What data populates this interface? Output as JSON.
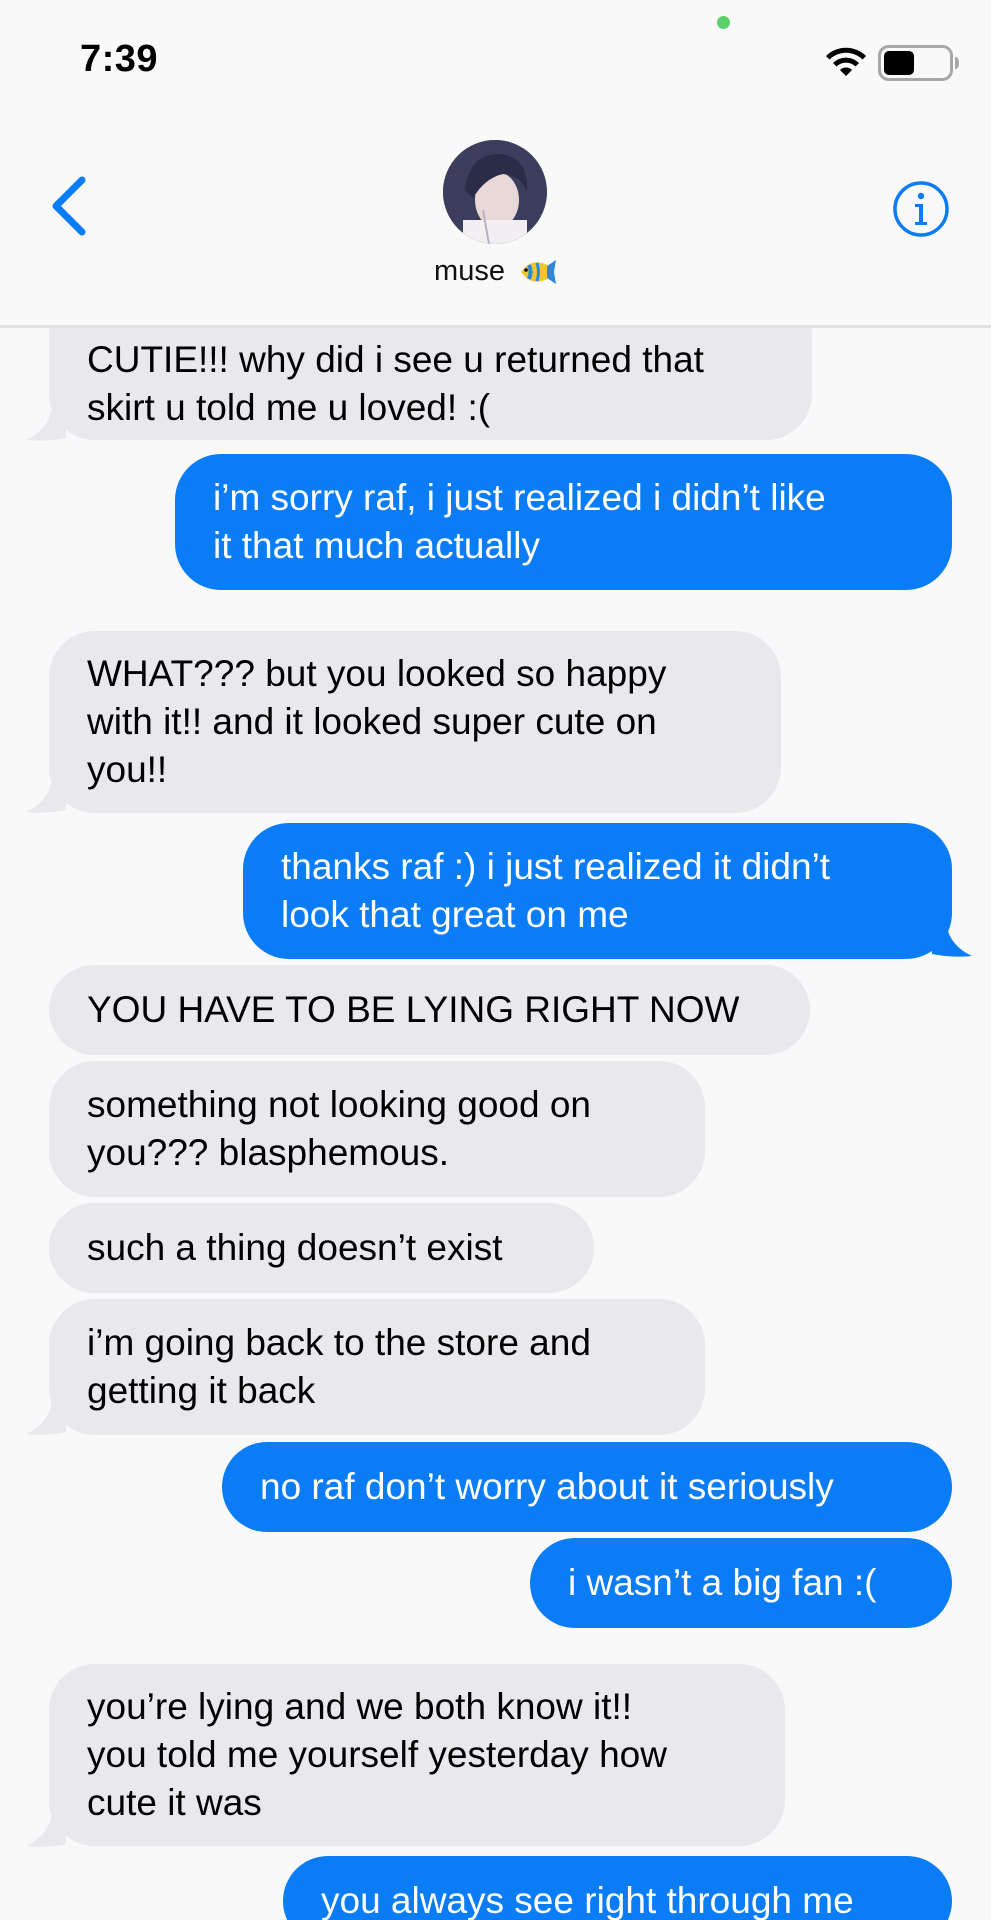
{
  "status_bar": {
    "time": "7:39",
    "wifi_icon": "wifi-icon",
    "battery_icon": "battery-icon"
  },
  "header": {
    "contact_name": "muse",
    "contact_emoji": "🐠",
    "back_icon": "chevron-left-icon",
    "info_icon": "info-icon"
  },
  "colors": {
    "incoming_bubble": "#e8e8ed",
    "outgoing_bubble": "#0a7cf5",
    "accent": "#0a7cf5",
    "background": "#f9f9f9"
  },
  "messages": [
    {
      "direction": "incoming",
      "text": "CUTIE!!! why did i see u returned that\nskirt u told me u loved! :("
    },
    {
      "direction": "outgoing",
      "text": "i’m sorry raf, i just realized i didn’t like\nit that much actually"
    },
    {
      "direction": "incoming",
      "text": "WHAT??? but you looked so happy\nwith it!! and it looked super cute on\nyou!!"
    },
    {
      "direction": "outgoing",
      "text": "thanks raf :) i just realized it didn’t\nlook that great on me"
    },
    {
      "direction": "incoming",
      "text": "YOU HAVE TO BE LYING RIGHT NOW"
    },
    {
      "direction": "incoming",
      "text": "something not looking good on\nyou??? blasphemous."
    },
    {
      "direction": "incoming",
      "text": "such a thing doesn’t exist"
    },
    {
      "direction": "incoming",
      "text": "i’m going back to the store and\ngetting it back"
    },
    {
      "direction": "outgoing",
      "text": "no raf don’t worry about it seriously"
    },
    {
      "direction": "outgoing",
      "text": "i wasn’t a big fan :("
    },
    {
      "direction": "incoming",
      "text": "you’re lying and we both know it!!\nyou told me yourself yesterday how\ncute it was"
    },
    {
      "direction": "outgoing",
      "text": "you always see right through me"
    }
  ]
}
